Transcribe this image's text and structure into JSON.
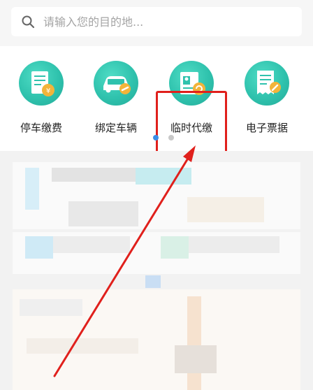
{
  "search": {
    "placeholder": "请输入您的目的地...",
    "icon": "search-icon"
  },
  "services": [
    {
      "label": "停车缴费",
      "icon": "parking-payment-icon"
    },
    {
      "label": "绑定车辆",
      "icon": "bind-vehicle-icon"
    },
    {
      "label": "临时代缴",
      "icon": "temporary-payment-icon"
    },
    {
      "label": "电子票据",
      "icon": "e-receipt-icon"
    }
  ],
  "pager": {
    "pages": 2,
    "current": 1
  },
  "colors": {
    "brand": "#2fc2ad",
    "highlight": "#e0201c",
    "dot_active": "#3a8ee6",
    "dot_inactive": "#c8c8c8"
  }
}
